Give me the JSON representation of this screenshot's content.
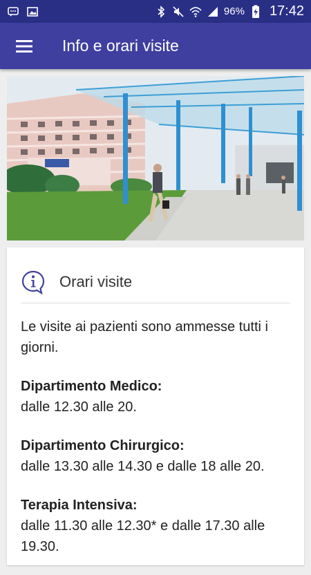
{
  "status_bar": {
    "battery": "96%",
    "time": "17:42"
  },
  "app_bar": {
    "title": "Info e orari visite"
  },
  "hero": {
    "description": ""
  },
  "visits_card": {
    "title": "Orari visite",
    "intro": "Le visite ai pazienti sono ammesse tutti i giorni.",
    "departments": [
      {
        "name": "Dipartimento Medico:",
        "hours": "dalle 12.30 alle 20."
      },
      {
        "name": "Dipartimento Chirurgico:",
        "hours": "dalle 13.30 alle 14.30 e dalle 18 alle 20."
      },
      {
        "name": "Terapia Intensiva:",
        "hours": "dalle 11.30 alle 12.30* e dalle 17.30 alle 19.30."
      }
    ]
  },
  "colors": {
    "status_bar": "#2a2f86",
    "app_bar": "#3f3fa0",
    "accent": "#3f3fa0"
  },
  "icons": {
    "menu": "hamburger-menu-icon",
    "info": "info-speech-bubble-icon"
  }
}
